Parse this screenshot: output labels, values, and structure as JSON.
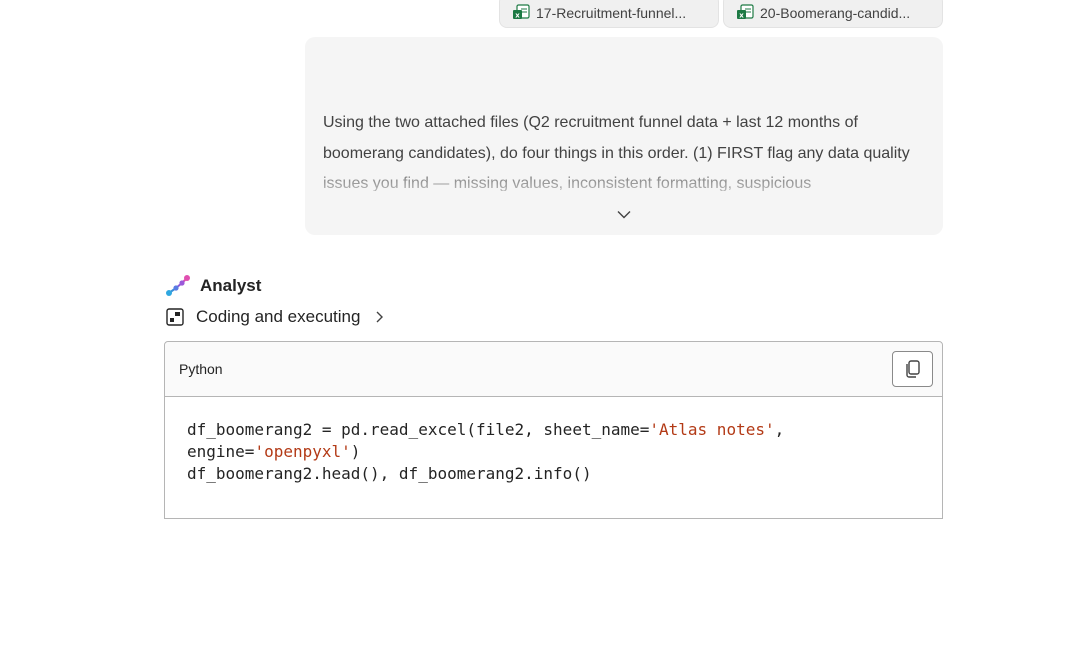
{
  "attachments": [
    {
      "name": "17-Recruitment-funnel...",
      "icon": "excel-file-icon"
    },
    {
      "name": "20-Boomerang-candid...",
      "icon": "excel-file-icon"
    }
  ],
  "user_message": {
    "text": "Using the two attached files (Q2 recruitment funnel data + last 12 months of boomerang candidates), do four things in this order. (1) FIRST flag any data quality issues you find — missing values, inconsistent formatting, suspicious"
  },
  "assistant": {
    "name": "Analyst",
    "status": "Coding and executing"
  },
  "code_block": {
    "language": "Python",
    "line1_code": "df_boomerang2 = pd.read_excel(file2, sheet_name=",
    "line1_string": "'Atlas notes'",
    "line1_end": ",",
    "line2_code": "engine=",
    "line2_string": "'openpyxl'",
    "line2_end": ")",
    "line3_code": "df_boomerang2.head(), df_boomerang2.info()"
  },
  "colors": {
    "excel_green": "#1d7a44",
    "string_literal": "#b33a16",
    "bubble_bg": "#f5f5f5"
  }
}
